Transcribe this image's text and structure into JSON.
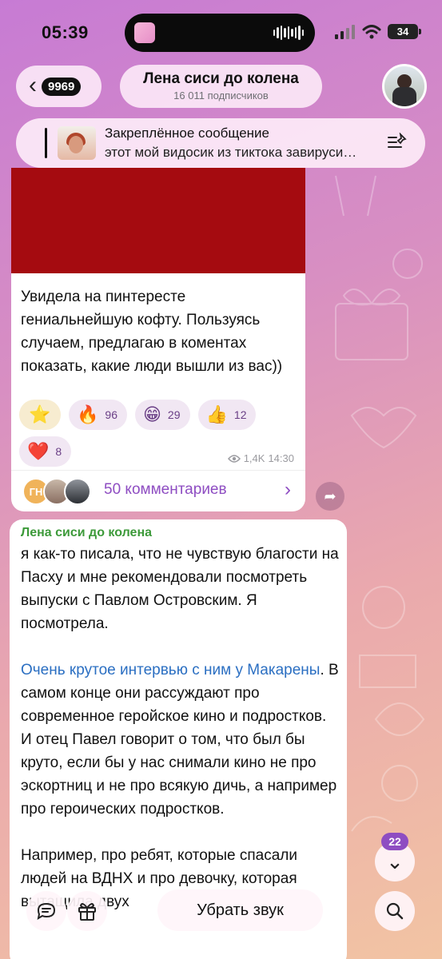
{
  "status_bar": {
    "time": "05:39",
    "battery": "34"
  },
  "header": {
    "back_count": "9969",
    "channel_title": "Лена сиси до колена",
    "subscribers": "16 011 подписчиков"
  },
  "pinned": {
    "title": "Закреплённое сообщение",
    "preview": "этот мой видосик из тиктока завируси…"
  },
  "message1": {
    "text": "Увидела на пинтересте гениальнейшую кофту. Пользуясь случаем, предлагаю в коментах показать, какие люди вышли из вас))",
    "reactions": [
      {
        "emoji": "⭐",
        "count": ""
      },
      {
        "emoji": "🔥",
        "count": "96"
      },
      {
        "emoji": "😁",
        "count": "29"
      },
      {
        "emoji": "👍",
        "count": "12"
      },
      {
        "emoji": "❤️",
        "count": "8"
      }
    ],
    "views": "1,4K",
    "time": "14:30",
    "comment_avatar_initials": "ГН",
    "comments_label": "50 комментариев"
  },
  "message2": {
    "author": "Лена сиси до колена",
    "para1": "я как-то писала, что не чувствую благости на Пасху и мне рекомендовали посмотреть выпуски с Павлом Островским. Я посмотрела.",
    "link_text": "Очень крутое интервью с ним у Макарены",
    "para2_rest": ". В самом конце они рассуждают про современное геройское кино и подростков. И отец Павел говорит о том, что был бы круто, если бы у нас снимали кино не про эскортниц и не про всякую дичь, а например про героических подростков.",
    "para3": "Например, про ребят, которые спасали людей на ВДНХ и про девочку, которая вытащила двух"
  },
  "bottom": {
    "unmute_label": "Убрать звук",
    "unread_badge": "22"
  },
  "colors": {
    "accent": "#8e4dc2",
    "author_green": "#3d9a3a",
    "link_blue": "#2b6fc2",
    "media_red": "#a50b10"
  }
}
